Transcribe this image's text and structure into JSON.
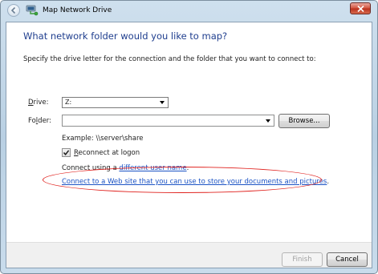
{
  "window": {
    "title": "Map Network Drive"
  },
  "page": {
    "heading": "What network folder would you like to map?",
    "instruction": "Specify the drive letter for the connection and the folder that you want to connect to:"
  },
  "drive": {
    "label_accel": "D",
    "label_rest": "rive:",
    "value": "Z:"
  },
  "folder": {
    "label_pre": "Fo",
    "label_accel": "l",
    "label_rest": "der:",
    "value": "",
    "browse_label": "Browse..."
  },
  "example": "Example: \\\\server\\share",
  "reconnect": {
    "checked": true,
    "label_accel": "R",
    "label_rest": "econnect at logon"
  },
  "connect_using": {
    "prefix": "Connect using a ",
    "link": "different user name",
    "suffix": "."
  },
  "web_link": "Connect to a Web site that you can use to store your documents and pictures",
  "web_link_suffix": ".",
  "footer": {
    "finish_label": "Finish",
    "cancel_label": "Cancel"
  },
  "colors": {
    "heading": "#1f3e8e",
    "link": "#1b53c4",
    "highlight": "#e0221e"
  }
}
